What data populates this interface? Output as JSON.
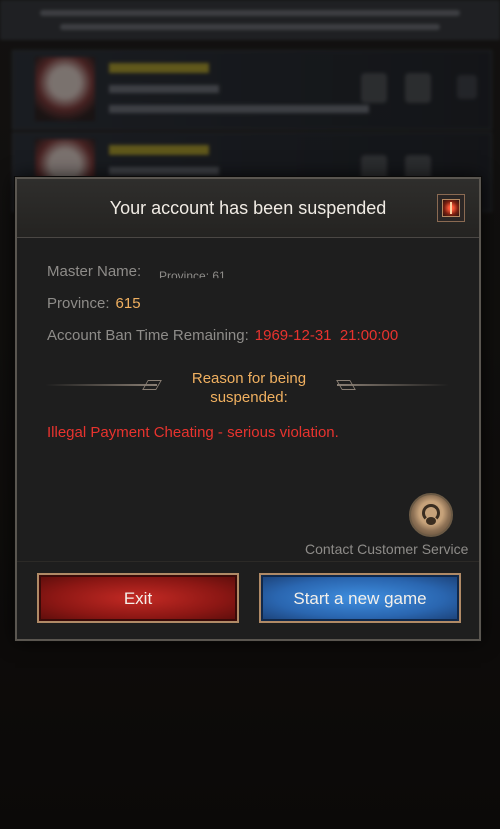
{
  "dialog": {
    "title": "Your account has been suspended",
    "close_icon": "close-icon",
    "master_name_label": "Master Name:",
    "master_name_overlap_text": "Province: 61",
    "province_label": "Province:",
    "province_value": "615",
    "ban_time_label": "Account Ban Time Remaining:",
    "ban_time_value": "1969-12-31  21:00:00",
    "reason_title": "Reason for being suspended:",
    "reason_text": "Illegal Payment Cheating - serious violation.",
    "contact_label": "Contact Customer Service",
    "contact_icon": "headset-avatar-icon",
    "exit_label": "Exit",
    "new_game_label": "Start a new game"
  },
  "colors": {
    "accent_orange": "#f0b060",
    "alert_red": "#e8332e",
    "exit_red": "#c42a24",
    "new_game_blue": "#3f8fe0"
  }
}
